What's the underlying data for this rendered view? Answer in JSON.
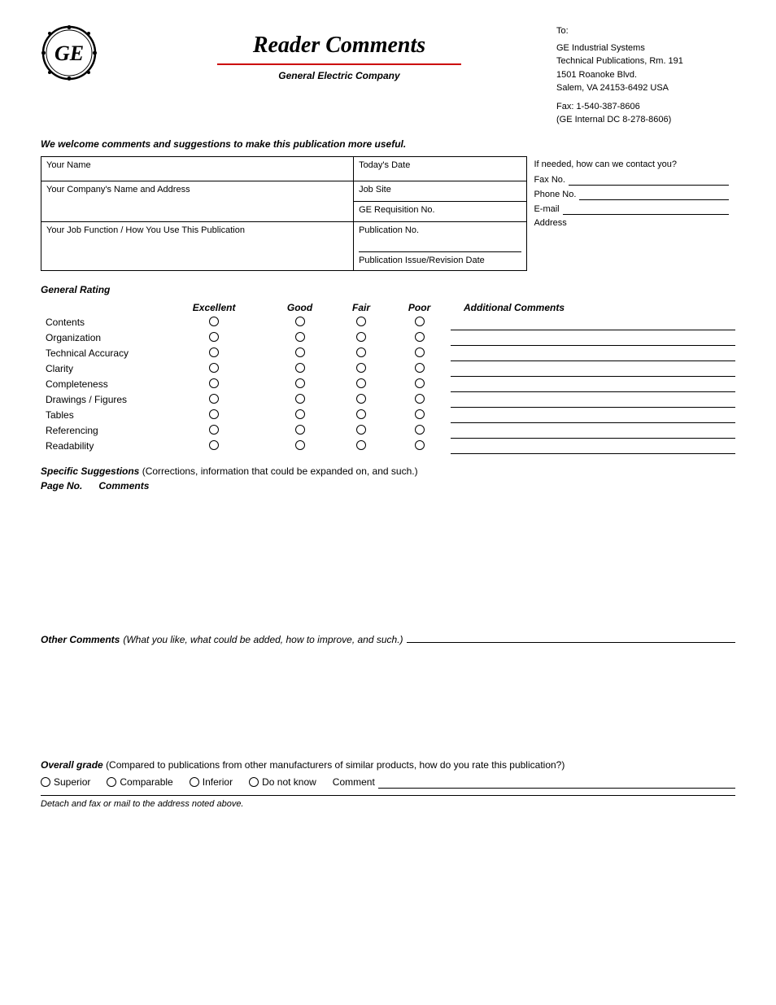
{
  "header": {
    "title": "Reader Comments",
    "subtitle": "General Electric Company",
    "address": {
      "to": "To:",
      "line1": "GE Industrial Systems",
      "line2": "Technical Publications, Rm. 191",
      "line3": "1501 Roanoke Blvd.",
      "line4": "Salem,  VA  24153-6492  USA",
      "fax_label": "Fax:  1-540-387-8606",
      "fax_internal": "(GE Internal DC 8-278-8606)"
    }
  },
  "welcome": "We welcome comments and suggestions to make this publication more useful.",
  "form_fields": {
    "your_name": "Your Name",
    "todays_date": "Today's Date",
    "contact_header": "If needed, how can we contact you?",
    "fax_label": "Fax No.",
    "phone_label": "Phone No.",
    "email_label": "E-mail",
    "address_label": "Address",
    "company_name": "Your Company's Name and Address",
    "job_site": "Job Site",
    "ge_req": "GE Requisition No.",
    "job_function": "Your Job Function / How You Use This Publication",
    "pub_no": "Publication No.",
    "pub_issue": "Publication Issue/Revision Date"
  },
  "rating": {
    "section_title": "General Rating",
    "columns": {
      "excellent": "Excellent",
      "good": "Good",
      "fair": "Fair",
      "poor": "Poor",
      "additional": "Additional Comments"
    },
    "rows": [
      "Contents",
      "Organization",
      "Technical Accuracy",
      "Clarity",
      "Completeness",
      "Drawings / Figures",
      "Tables",
      "Referencing",
      "Readability"
    ]
  },
  "specific_suggestions": {
    "title": "Specific Suggestions",
    "desc": "(Corrections, information that could be expanded on, and such.)",
    "page_no_label": "Page No.",
    "comments_label": "Comments"
  },
  "other_comments": {
    "label": "Other Comments",
    "desc": "(What you like, what could be added, how to improve, and such.)"
  },
  "overall_grade": {
    "title": "Overall grade",
    "desc": "(Compared to publications from other manufacturers of similar products, how do you rate this publication?)",
    "options": [
      "Superior",
      "Comparable",
      "Inferior",
      "Do not know"
    ],
    "comment_label": "Comment"
  },
  "footer": {
    "text": "Detach and fax or mail to the address noted above."
  }
}
